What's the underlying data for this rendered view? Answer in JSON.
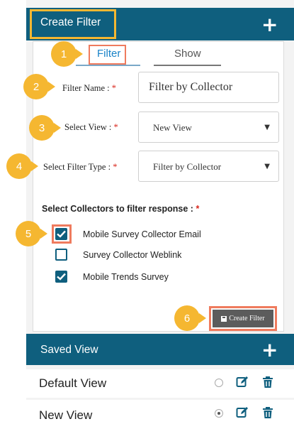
{
  "create_filter": {
    "title": "Create Filter",
    "add_icon": "plus-icon"
  },
  "tabs": [
    {
      "label": "Filter",
      "active": true
    },
    {
      "label": "Show",
      "active": false
    }
  ],
  "form": {
    "filter_name_label": "Filter Name :",
    "filter_name_value": "Filter by Collector",
    "select_view_label": "Select View :",
    "select_view_value": "New View",
    "filter_type_label": "Select Filter Type :",
    "filter_type_value": "Filter by Collector",
    "required_mark": "*"
  },
  "collectors": {
    "title": "Select Collectors to filter response :",
    "required_mark": "*",
    "items": [
      {
        "label": "Mobile Survey Collector Email",
        "checked": true
      },
      {
        "label": "Survey Collector Weblink",
        "checked": false
      },
      {
        "label": "Mobile Trends Survey",
        "checked": true
      }
    ]
  },
  "create_button": {
    "label": "Create Filter",
    "icon": "save-icon"
  },
  "steps": [
    "1",
    "2",
    "3",
    "4",
    "5",
    "6"
  ],
  "saved_view": {
    "title": "Saved View",
    "add_icon": "plus-icon",
    "views": [
      {
        "name": "Default View",
        "selected": false
      },
      {
        "name": "New View",
        "selected": true
      }
    ]
  },
  "colors": {
    "header": "#0f5f7e",
    "highlight_box": "#f5b731",
    "step_badge": "#f5b731",
    "focus_outline": "#ef7b5e",
    "required": "#d9261c",
    "button": "#5c5c5c"
  }
}
